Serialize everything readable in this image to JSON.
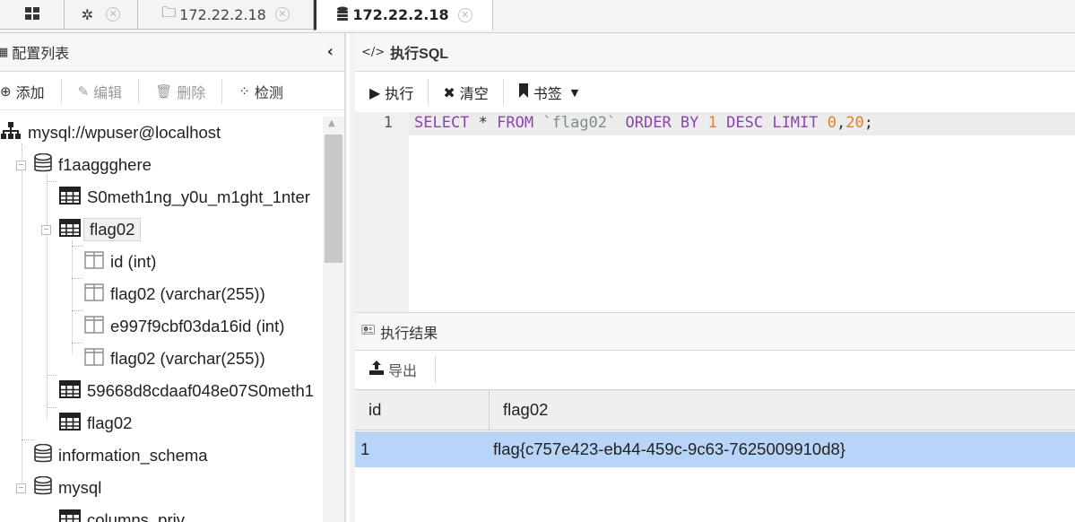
{
  "tabs": [
    {
      "icon": "grid-icon"
    },
    {
      "icon": "gear-icon"
    },
    {
      "icon": "folder-icon",
      "label": "172.22.2.18"
    },
    {
      "icon": "database-icon",
      "label": "172.22.2.18",
      "active": true
    }
  ],
  "left_panel": {
    "title": "配置列表",
    "toolbar": {
      "add": "添加",
      "edit": "编辑",
      "delete": "删除",
      "detect": "检测"
    },
    "tree": {
      "connection": "mysql://wpuser@localhost",
      "db1": "f1aaggghere",
      "table1": "S0meth1ng_y0u_m1ght_1nter",
      "table2": "flag02",
      "col1": "id (int)",
      "col2": "flag02 (varchar(255))",
      "col3": "e997f9cbf03da16id (int)",
      "col4": "flag02 (varchar(255))",
      "table3": "59668d8cdaaf048e07S0meth1",
      "table4": "flag02",
      "db2": "information_schema",
      "db3": "mysql",
      "db3_table1": "columns_priv"
    }
  },
  "sql_panel": {
    "title": "执行SQL",
    "toolbar": {
      "run": "执行",
      "clear": "清空",
      "bookmark": "书签"
    },
    "line_number": "1",
    "tokens": {
      "t1": "SELECT",
      "t2": "*",
      "t3": "FROM",
      "t4": "`flag02`",
      "t5": "ORDER BY",
      "t6": "1",
      "t7": "DESC LIMIT",
      "t8": "0",
      "t9": ",",
      "t10": "20",
      "t11": ";"
    }
  },
  "result_panel": {
    "title": "执行结果",
    "export": "导出",
    "columns": [
      "id",
      "flag02"
    ],
    "rows": [
      [
        "1",
        "flag{c757e423-eb44-459c-9c63-7625009910d8}"
      ]
    ]
  }
}
